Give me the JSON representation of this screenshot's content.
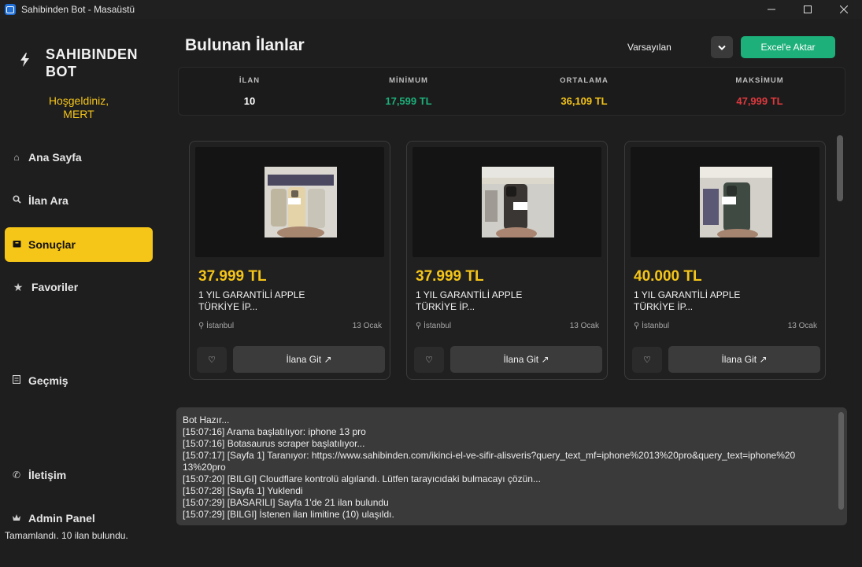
{
  "window": {
    "title": "Sahibinden Bot - Masaüstü",
    "controls": [
      "—",
      "☐",
      "✕"
    ]
  },
  "sidebar": {
    "brand_line1": "SAHIBINDEN",
    "brand_line2": "BOT",
    "welcome_line1": "Hoşgeldiniz,",
    "welcome_line2": "MERT",
    "items": [
      {
        "label": "Ana Sayfa",
        "icon": "home-icon"
      },
      {
        "label": "İlan Ara",
        "icon": "search-icon"
      },
      {
        "label": "Sonuçlar",
        "icon": "box-icon",
        "active": true
      },
      {
        "label": "Favoriler",
        "icon": "star-icon"
      },
      {
        "label": "Geçmiş",
        "icon": "history-icon"
      },
      {
        "label": "İletişim",
        "icon": "phone-icon"
      },
      {
        "label": "Admin Panel",
        "icon": "admin-icon"
      }
    ],
    "status": "Tamamlandı. 10 ilan bulundu."
  },
  "header": {
    "title": "Bulunan İlanlar",
    "sort_value": "Varsayılan",
    "export_label": "Excel'e Aktar"
  },
  "stats": [
    {
      "label": "İLAN",
      "value": "10",
      "color": "#ffffff"
    },
    {
      "label": "MİNİMUM",
      "value": "17,599 TL",
      "color": "#1db07a"
    },
    {
      "label": "ORTALAMA",
      "value": "36,109 TL",
      "color": "#f5c518"
    },
    {
      "label": "MAKSİMUM",
      "value": "47,999 TL",
      "color": "#e0393e"
    }
  ],
  "cards": [
    {
      "price": "37.999 TL",
      "title_line1": "1 YIL GARANTİLİ APPLE",
      "title_line2": "TÜRKİYE İP...",
      "location": "İstanbul",
      "date": "13 Ocak",
      "button": "İlana Git ↗"
    },
    {
      "price": "37.999 TL",
      "title_line1": "1 YIL GARANTİLİ APPLE",
      "title_line2": "TÜRKİYE İP...",
      "location": "İstanbul",
      "date": "13 Ocak",
      "button": "İlana Git ↗"
    },
    {
      "price": "40.000 TL",
      "title_line1": "1 YIL GARANTİLİ APPLE",
      "title_line2": "TÜRKİYE İP...",
      "location": "İstanbul",
      "date": "13 Ocak",
      "button": "İlana Git ↗"
    }
  ],
  "log": [
    "Bot Hazır...",
    "[15:07:16] Arama başlatılıyor: iphone 13 pro",
    "[15:07:16] Botasaurus scraper başlatılıyor...",
    "[15:07:17] [Sayfa 1] Taranıyor: https://www.sahibinden.com/ikinci-el-ve-sifir-alisveris?query_text_mf=iphone%2013%20pro&query_text=iphone%20",
    "13%20pro",
    "[15:07:20] [BILGI] Cloudflare kontrolü algılandı. Lütfen tarayıcıdaki bulmacayı çözün...",
    "[15:07:28] [Sayfa 1] Yuklendi",
    "[15:07:29] [BASARILI] Sayfa 1'de 21 ilan bulundu",
    "[15:07:29] [BILGI] İstenen ilan limitine (10) ulaşıldı."
  ]
}
